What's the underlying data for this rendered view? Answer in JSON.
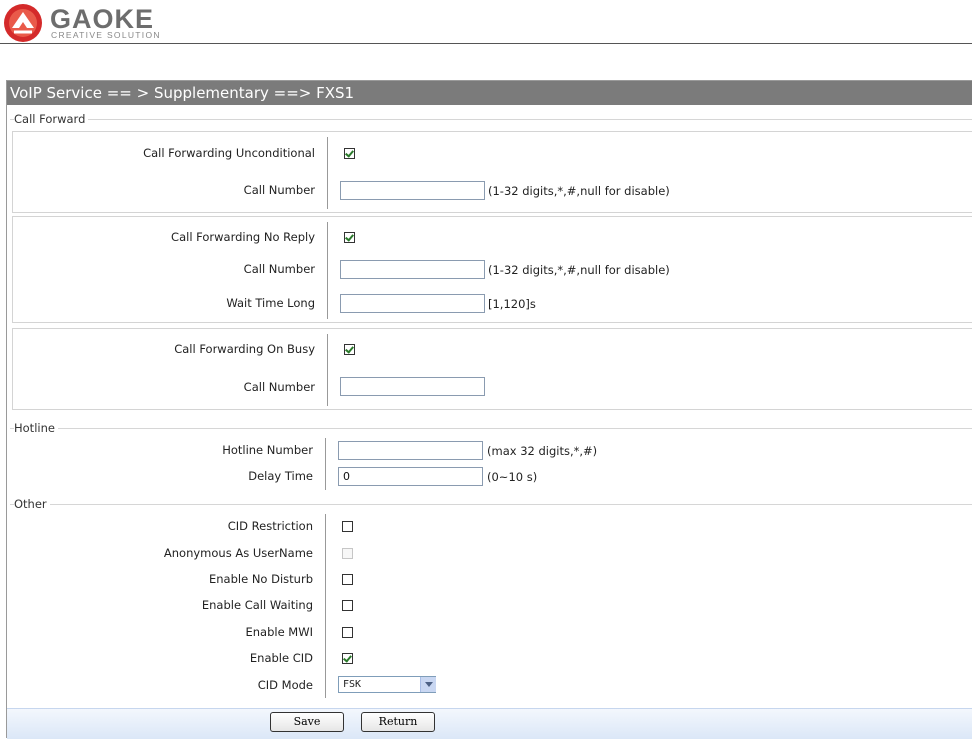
{
  "header": {
    "logo_text": "GAOKE",
    "logo_tagline": "CREATIVE SOLUTION"
  },
  "title": "VoIP Service == > Supplementary ==> FXS1",
  "call_forward": {
    "section_label": "Call Forward",
    "unconditional": {
      "label": "Call Forwarding Unconditional",
      "checked": true,
      "call_number_label": "Call Number",
      "call_number_value": "",
      "hint": "(1-32 digits,*,#,null for disable)"
    },
    "no_reply": {
      "label": "Call Forwarding No Reply",
      "checked": true,
      "call_number_label": "Call Number",
      "call_number_value": "",
      "hint": "(1-32 digits,*,#,null for disable)",
      "wait_label": "Wait Time Long",
      "wait_value": "",
      "wait_hint": "[1,120]s"
    },
    "on_busy": {
      "label": "Call Forwarding On Busy",
      "checked": true,
      "call_number_label": "Call Number",
      "call_number_value": ""
    }
  },
  "hotline": {
    "section_label": "Hotline",
    "number_label": "Hotline Number",
    "number_value": "",
    "number_hint": "(max 32 digits,*,#)",
    "delay_label": "Delay Time",
    "delay_value": "0",
    "delay_hint": "(0~10 s)"
  },
  "other": {
    "section_label": "Other",
    "cid_restriction": {
      "label": "CID Restriction",
      "checked": false
    },
    "anonymous_username": {
      "label": "Anonymous As UserName",
      "checked": false,
      "disabled": true
    },
    "no_disturb": {
      "label": "Enable No Disturb",
      "checked": false
    },
    "call_waiting": {
      "label": "Enable Call Waiting",
      "checked": false
    },
    "mwi": {
      "label": "Enable MWI",
      "checked": false
    },
    "cid": {
      "label": "Enable CID",
      "checked": true
    },
    "cid_mode": {
      "label": "CID Mode",
      "value": "FSK"
    }
  },
  "buttons": {
    "save": "Save",
    "return": "Return"
  },
  "colors": {
    "titlebar": "#7b7b7b",
    "brand_red": "#d42a2a",
    "check_green": "#2a7a2a"
  }
}
